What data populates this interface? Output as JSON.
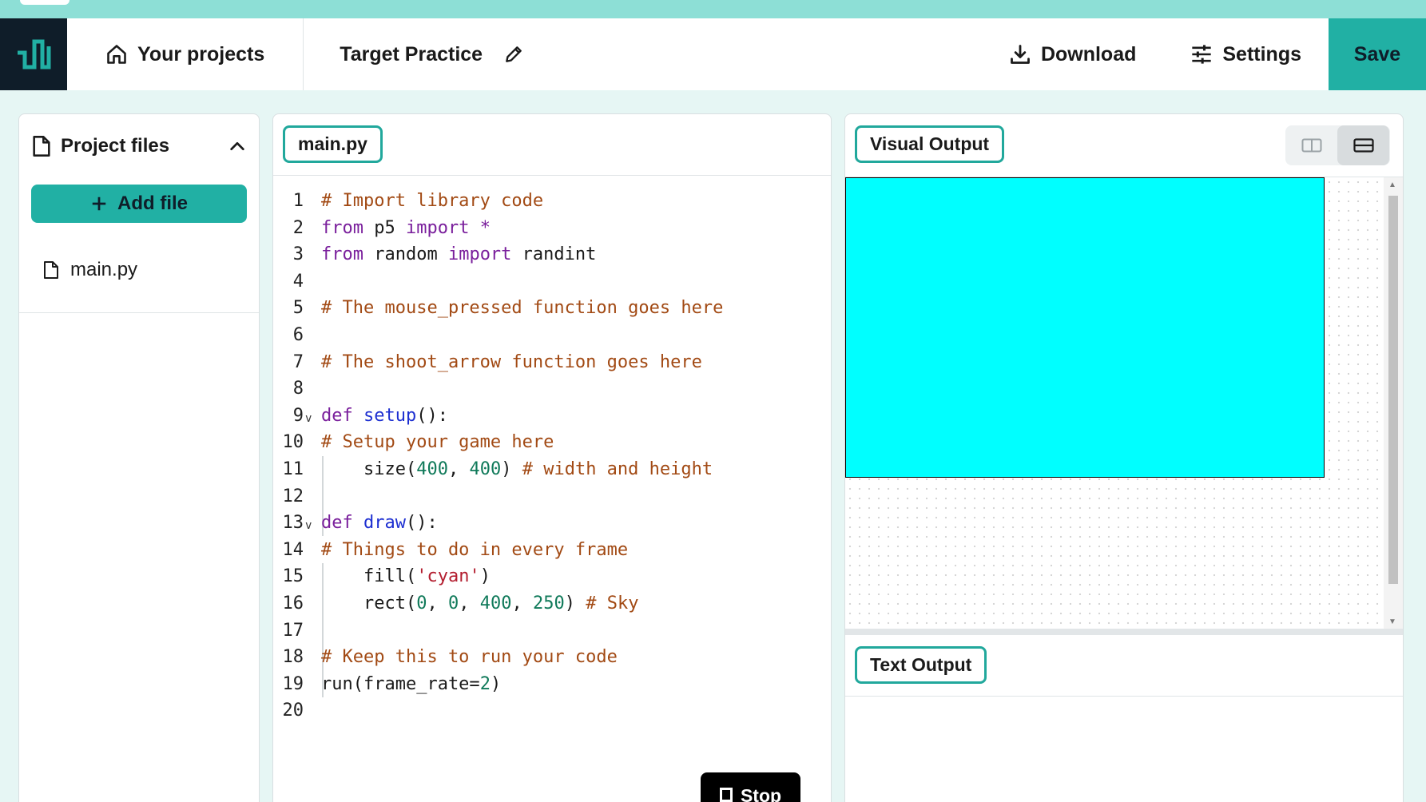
{
  "header": {
    "your_projects": "Your projects",
    "project_title": "Target Practice",
    "download": "Download",
    "settings": "Settings",
    "save": "Save"
  },
  "sidebar": {
    "title": "Project files",
    "add_file": "Add file",
    "files": [
      "main.py"
    ]
  },
  "editor": {
    "tab": "main.py",
    "lines": [
      "# Import library code",
      "from p5 import *",
      "from random import randint",
      "",
      "# The mouse_pressed function goes here",
      "",
      "# The shoot_arrow function goes here",
      "",
      "def setup():",
      "# Setup your game here",
      "    size(400, 400) # width and height",
      "",
      "def draw():",
      "# Things to do in every frame",
      "    fill('cyan')",
      "    rect(0, 0, 400, 250) # Sky",
      "",
      "# Keep this to run your code",
      "run(frame_rate=2)",
      ""
    ],
    "stop": "Stop"
  },
  "output": {
    "visual_tab": "Visual Output",
    "text_tab": "Text Output",
    "canvas_fill": "#00ffff"
  },
  "colors": {
    "accent": "#21b0a4",
    "logo_bg": "#0f1d29",
    "page_bg": "#e6f6f4"
  }
}
